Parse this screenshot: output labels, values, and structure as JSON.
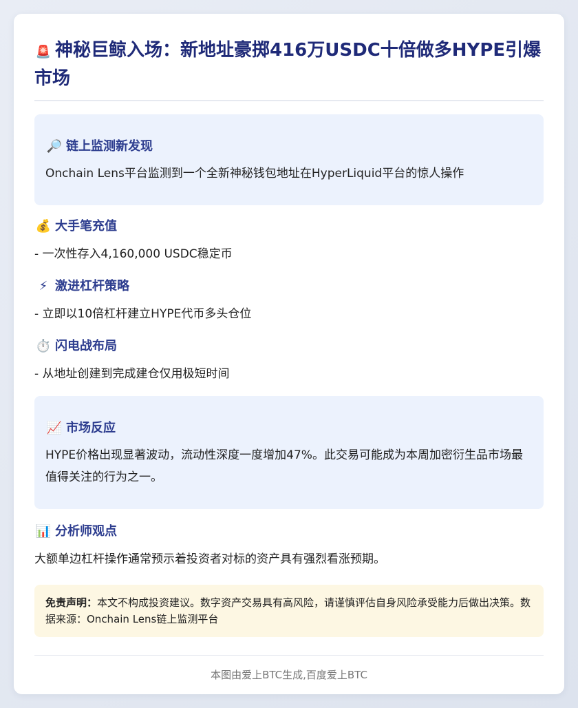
{
  "title": {
    "icon": "siren-icon",
    "emoji": "🚨",
    "text": "神秘巨鲸入场：新地址豪掷416万USDC十倍做多HYPE引爆市场"
  },
  "discovery": {
    "icon": "magnifier-icon",
    "emoji": "🔎",
    "heading": "链上监测新发现",
    "body": "Onchain Lens平台监测到一个全新神秘钱包地址在HyperLiquid平台的惊人操作"
  },
  "sections": [
    {
      "icon": "money-bag-icon",
      "emoji": "💰",
      "heading": "大手笔充值",
      "body": "- 一次性存入4,160,000 USDC稳定币"
    },
    {
      "icon": "lightning-icon",
      "emoji": "⚡",
      "heading": "激进杠杆策略",
      "body": "- 立即以10倍杠杆建立HYPE代币多头仓位"
    },
    {
      "icon": "stopwatch-icon",
      "emoji": "⏱️",
      "heading": "闪电战布局",
      "body": "- 从地址创建到完成建仓仅用极短时间"
    }
  ],
  "market": {
    "icon": "chart-up-icon",
    "emoji": "📈",
    "heading": "市场反应",
    "body": "HYPE价格出现显著波动，流动性深度一度增加47%。此交易可能成为本周加密衍生品市场最值得关注的行为之一。"
  },
  "analyst": {
    "icon": "bar-chart-icon",
    "emoji": "📊",
    "heading": "分析师观点",
    "body": "大额单边杠杆操作通常预示着投资者对标的资产具有强烈看涨预期。"
  },
  "disclaimer": {
    "label": "免责声明：",
    "text": "本文不构成投资建议。数字资产交易具有高风险，请谨慎评估自身风险承受能力后做出决策。数据来源：Onchain Lens链上监测平台"
  },
  "footer": "本图由爱上BTC生成,百度爱上BTC"
}
